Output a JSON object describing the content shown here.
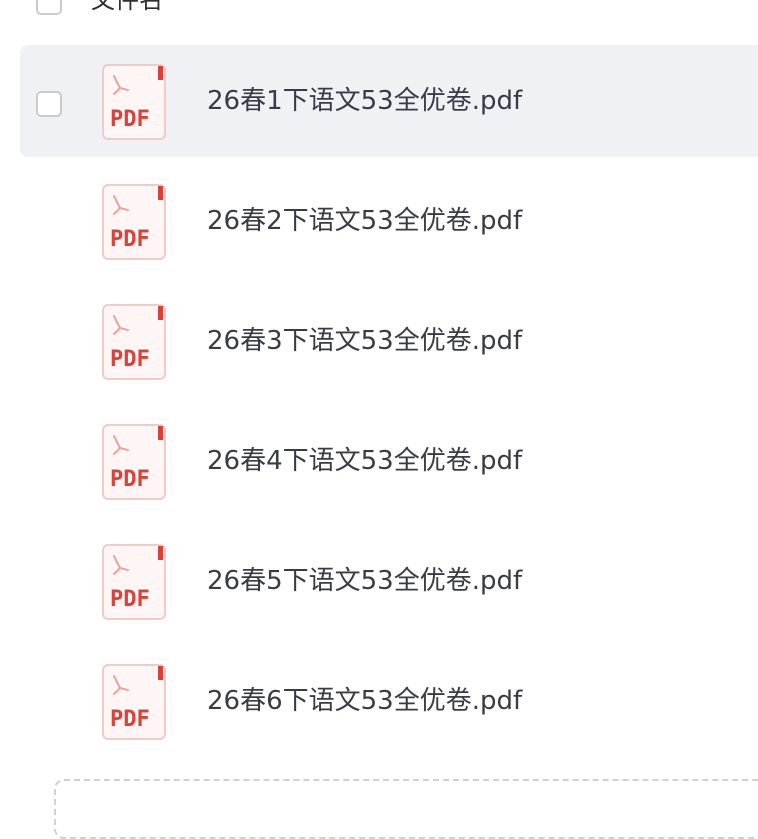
{
  "header": {
    "column_label": "文件名"
  },
  "files": [
    {
      "name": "26春1下语文53全优卷.pdf",
      "type_label": "PDF"
    },
    {
      "name": "26春2下语文53全优卷.pdf",
      "type_label": "PDF"
    },
    {
      "name": "26春3下语文53全优卷.pdf",
      "type_label": "PDF"
    },
    {
      "name": "26春4下语文53全优卷.pdf",
      "type_label": "PDF"
    },
    {
      "name": "26春5下语文53全优卷.pdf",
      "type_label": "PDF"
    },
    {
      "name": "26春6下语文53全优卷.pdf",
      "type_label": "PDF"
    }
  ],
  "colors": {
    "pdf_red": "#d9413a",
    "row_hover_bg": "#f0f1f4"
  },
  "icons": {
    "file_type": "pdf-file-icon"
  }
}
